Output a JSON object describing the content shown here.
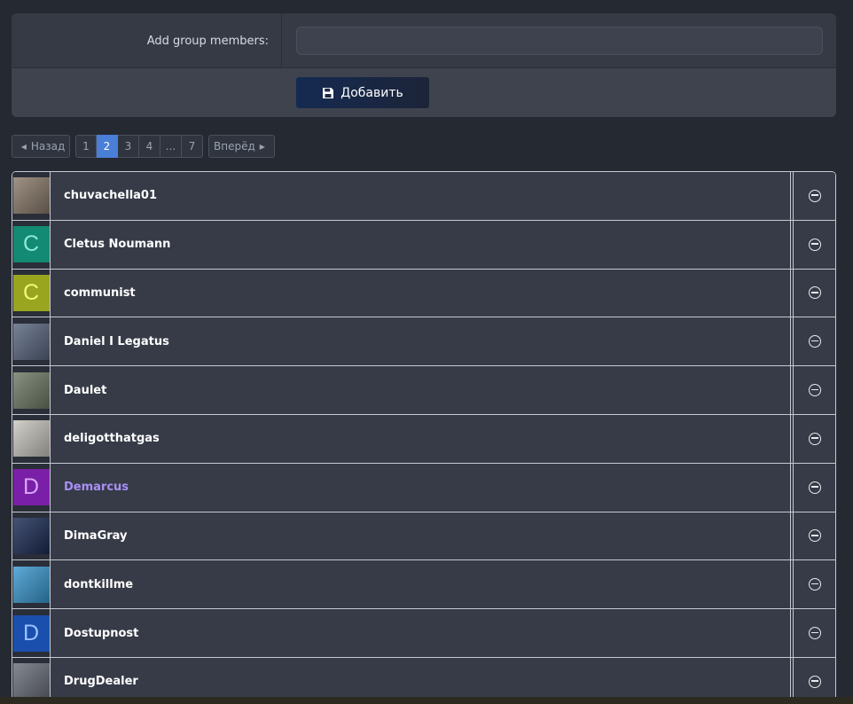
{
  "form": {
    "label": "Add group members:",
    "input_value": "",
    "input_placeholder": "",
    "submit_label": "Добавить"
  },
  "pagination": {
    "prev_label": "Назад",
    "next_label": "Вперёд",
    "pages": [
      "1",
      "2",
      "3",
      "4",
      "...",
      "7"
    ],
    "current": "2"
  },
  "members": [
    {
      "name": "chuvachella01",
      "avatar_type": "photo",
      "avatar_letter": "",
      "avatar_color": "#8a7a6a"
    },
    {
      "name": "Cletus Noumann",
      "avatar_type": "letter",
      "avatar_letter": "C",
      "avatar_color": "#138a73",
      "letter_color": "#8de8d4"
    },
    {
      "name": "communist",
      "avatar_type": "letter",
      "avatar_letter": "C",
      "avatar_color": "#9aa51f",
      "letter_color": "#f3f57c"
    },
    {
      "name": "Daniel I Legatus",
      "avatar_type": "photo",
      "avatar_letter": "",
      "avatar_color": "#5a6780"
    },
    {
      "name": "Daulet",
      "avatar_type": "photo",
      "avatar_letter": "",
      "avatar_color": "#6f7b66"
    },
    {
      "name": "deligotthatgas",
      "avatar_type": "photo",
      "avatar_letter": "",
      "avatar_color": "#c9c6be"
    },
    {
      "name": "Demarcus",
      "avatar_type": "letter",
      "avatar_letter": "D",
      "avatar_color": "#7a1fa8",
      "letter_color": "#d9a6f5",
      "highlight": true
    },
    {
      "name": "DimaGray",
      "avatar_type": "photo",
      "avatar_letter": "",
      "avatar_color": "#1c2c55"
    },
    {
      "name": "dontkillme",
      "avatar_type": "photo",
      "avatar_letter": "",
      "avatar_color": "#3a98cf"
    },
    {
      "name": "Dostupnost",
      "avatar_type": "letter",
      "avatar_letter": "D",
      "avatar_color": "#1a4fae",
      "letter_color": "#9cc2ff"
    },
    {
      "name": "DrugDealer",
      "avatar_type": "photo",
      "avatar_letter": "",
      "avatar_color": "#6a6f7a"
    }
  ]
}
